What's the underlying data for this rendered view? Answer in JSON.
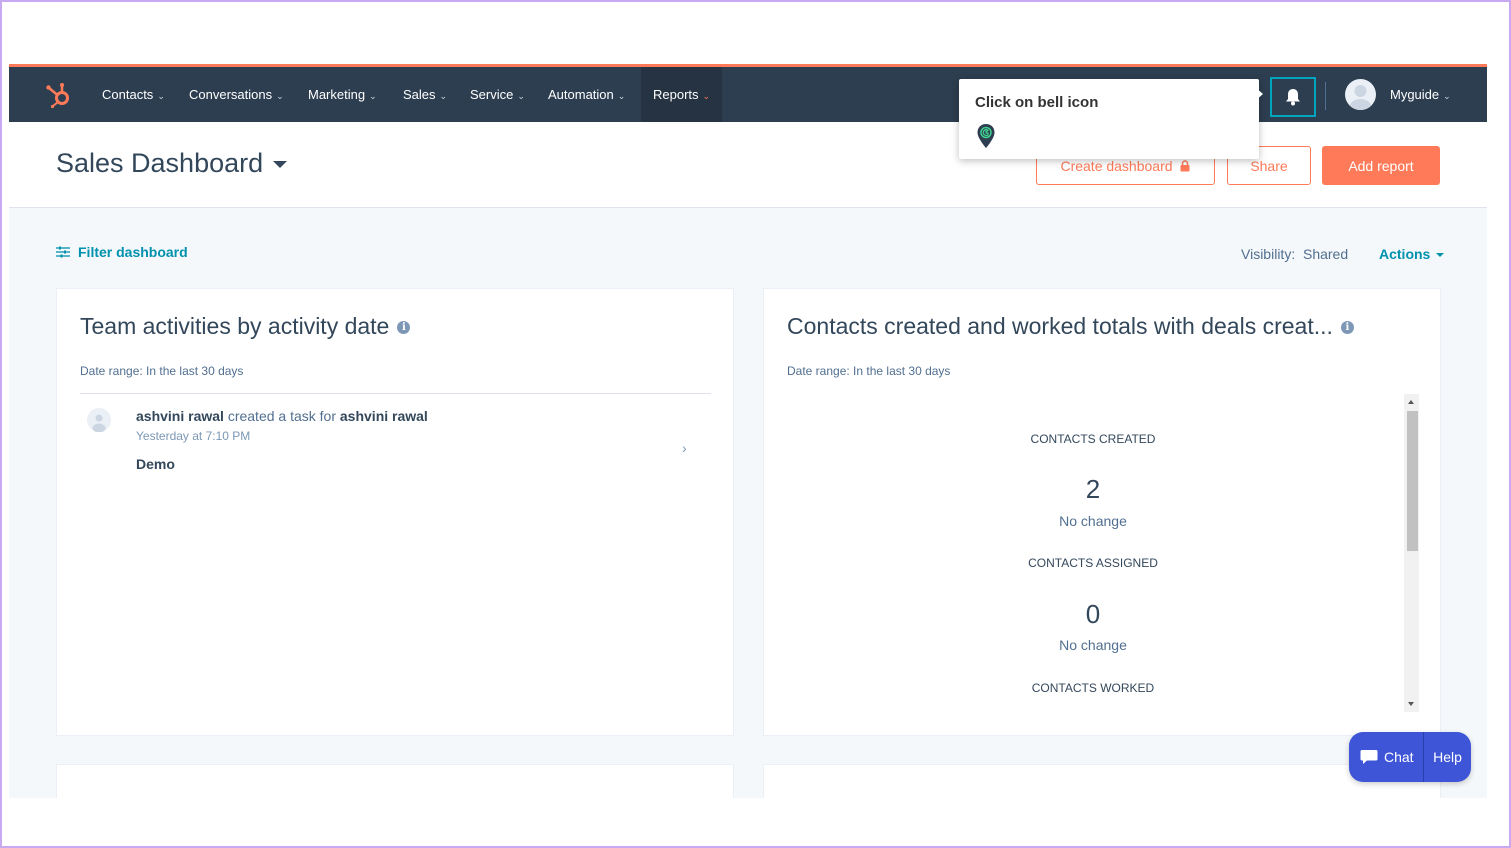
{
  "nav": {
    "items": [
      {
        "label": "Contacts"
      },
      {
        "label": "Conversations"
      },
      {
        "label": "Marketing"
      },
      {
        "label": "Sales"
      },
      {
        "label": "Service"
      },
      {
        "label": "Automation"
      },
      {
        "label": "Reports"
      }
    ],
    "active": "Reports",
    "user": "Myguide"
  },
  "header": {
    "title": "Sales Dashboard",
    "create_dashboard": "Create dashboard",
    "share": "Share",
    "add_report": "Add report"
  },
  "toolbar": {
    "filter": "Filter dashboard",
    "visibility": "Visibility:  Shared",
    "actions": "Actions"
  },
  "cards": {
    "team": {
      "title": "Team activities by activity date",
      "date_range": "Date range: In the last 30 days",
      "activity": {
        "actor": "ashvini rawal",
        "verb": " created a task for ",
        "target": "ashvini rawal",
        "time": "Yesterday at 7:10 PM",
        "subject": "Demo"
      }
    },
    "contacts": {
      "title": "Contacts created and worked totals with deals creat...",
      "date_range": "Date range: In the last 30 days",
      "metrics": [
        {
          "label": "CONTACTS CREATED",
          "value": "2",
          "change": "No change"
        },
        {
          "label": "CONTACTS ASSIGNED",
          "value": "0",
          "change": "No change"
        },
        {
          "label": "CONTACTS WORKED"
        }
      ]
    }
  },
  "tooltip": {
    "text": "Click on bell icon"
  },
  "chat": {
    "chat_label": "Chat",
    "help_label": "Help"
  },
  "colors": {
    "nav_bg": "#2d3e50",
    "accent_orange": "#ff7a59",
    "link_teal": "#0091ae",
    "chat_blue": "#3d55d6"
  },
  "icons": [
    "hubspot-logo-icon",
    "bell-icon",
    "avatar-icon",
    "filter-icon",
    "info-icon",
    "lock-icon",
    "chevron-right-icon",
    "chat-bubble-icon",
    "map-pin-icon"
  ]
}
